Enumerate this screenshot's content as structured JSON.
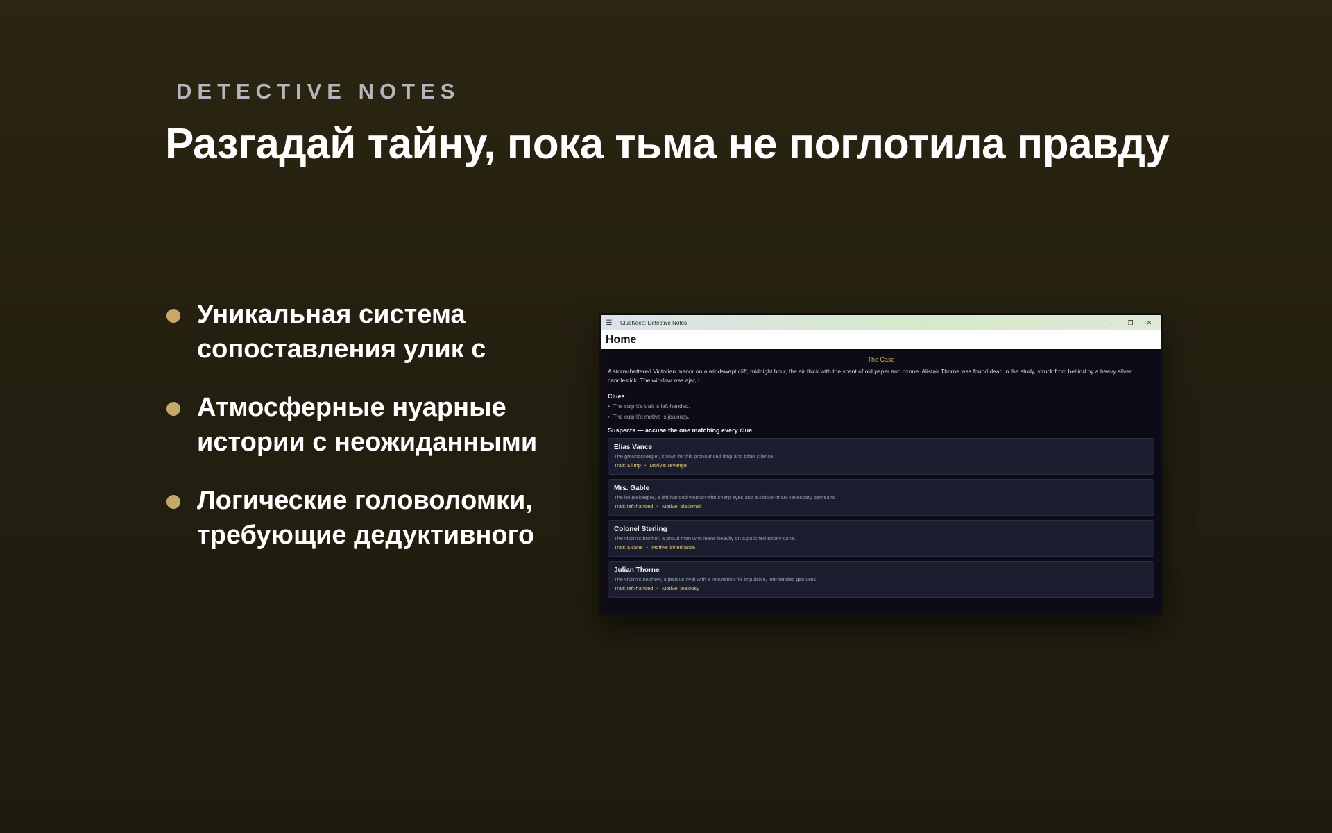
{
  "promo": {
    "eyebrow": "DETECTIVE NOTES",
    "headline": "Разгадай тайну, пока тьма не поглотила правду",
    "features": [
      {
        "line1": "Уникальная система",
        "line2": "сопоставления улик с"
      },
      {
        "line1": "Атмосферные нуарные",
        "line2": "истории с неожиданными"
      },
      {
        "line1": "Логические головоломки,",
        "line2": "требующие дедуктивного"
      }
    ]
  },
  "window": {
    "title": "ClueKeep: Detective Notes",
    "icons": {
      "menu": "hamburger-icon",
      "minimize": "minimize-icon",
      "maximize": "restore-icon",
      "close": "close-icon"
    },
    "page_title": "Home",
    "case_heading": "The Case",
    "case_text": "A storm-battered Victorian manor on a windswept cliff, midnight hour, the air thick with the scent of old paper and ozone. Alistair Thorne was found dead in the study, struck from behind by a heavy silver candlestick. The window was ajar, l",
    "clues_heading": "Clues",
    "clues": [
      "The culprit's trait is left-handed.",
      "The culprit's motive is jealousy."
    ],
    "suspects_heading": "Suspects — accuse the one matching every clue",
    "suspects": [
      {
        "name": "Elias Vance",
        "desc": "The groundskeeper, known for his pronounced limp and bitter silence.",
        "trait": "Trait: a limp",
        "motive": "Motive: revenge"
      },
      {
        "name": "Mrs. Gable",
        "desc": "The housekeeper, a left-handed woman with sharp eyes and a stricter-than-necessary demeano",
        "trait": "Trait: left-handed",
        "motive": "Motive: blackmail"
      },
      {
        "name": "Colonel Sterling",
        "desc": "The victim's brother, a proud man who leans heavily on a polished ebony cane.",
        "trait": "Trait: a cane",
        "motive": "Motive: inheritance"
      },
      {
        "name": "Julian Thorne",
        "desc": "The victim's nephew, a jealous rival with a reputation for impulsive, left-handed gestures",
        "trait": "Trait: left-handed",
        "motive": "Motive: jealousy"
      }
    ],
    "tag_separator": "•",
    "clue_bullet": "•"
  },
  "colors": {
    "background": "#231f10",
    "accent": "#c7a868",
    "case_heading": "#d4a64e",
    "tag": "#e9c97c"
  }
}
